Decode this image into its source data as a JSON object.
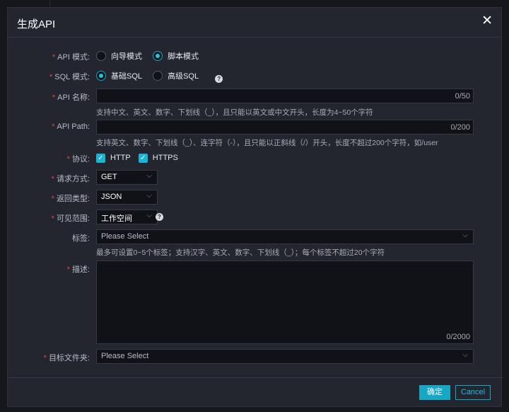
{
  "dialog": {
    "title": "生成API",
    "close": "✕"
  },
  "fields": {
    "api_mode": {
      "label": "API 模式:",
      "options": [
        "向导模式",
        "脚本模式"
      ],
      "selected": 1
    },
    "sql_mode": {
      "label": "SQL 模式:",
      "options": [
        "基础SQL",
        "高级SQL"
      ],
      "selected": 0,
      "help": "?"
    },
    "api_name": {
      "label": "API 名称:",
      "value": "",
      "count": "0/50",
      "hint": "支持中文、英文、数字、下划线（_），且只能以英文或中文开头，长度为4~50个字符"
    },
    "api_path": {
      "label": "API Path:",
      "value": "",
      "count": "0/200",
      "hint": "支持英文、数字、下划线（_）、连字符（-），且只能以正斜线（/）开头，长度不超过200个字符，如/user"
    },
    "protocol": {
      "label": "协议:",
      "options": [
        "HTTP",
        "HTTPS"
      ],
      "checked": [
        true,
        true
      ]
    },
    "method": {
      "label": "请求方式:",
      "value": "GET"
    },
    "return_type": {
      "label": "返回类型:",
      "value": "JSON"
    },
    "visibility": {
      "label": "可见范围:",
      "value": "工作空间",
      "help": "?"
    },
    "tags": {
      "label": "标签:",
      "placeholder": "Please Select",
      "hint": "最多可设置0~5个标签；支持汉字、英文、数字、下划线（_）；每个标签不超过20个字符"
    },
    "description": {
      "label": "描述:",
      "value": "",
      "count": "0/2000"
    },
    "target_folder": {
      "label": "目标文件夹:",
      "placeholder": "Please Select"
    }
  },
  "footer": {
    "ok": "确定",
    "cancel": "Cancel"
  }
}
